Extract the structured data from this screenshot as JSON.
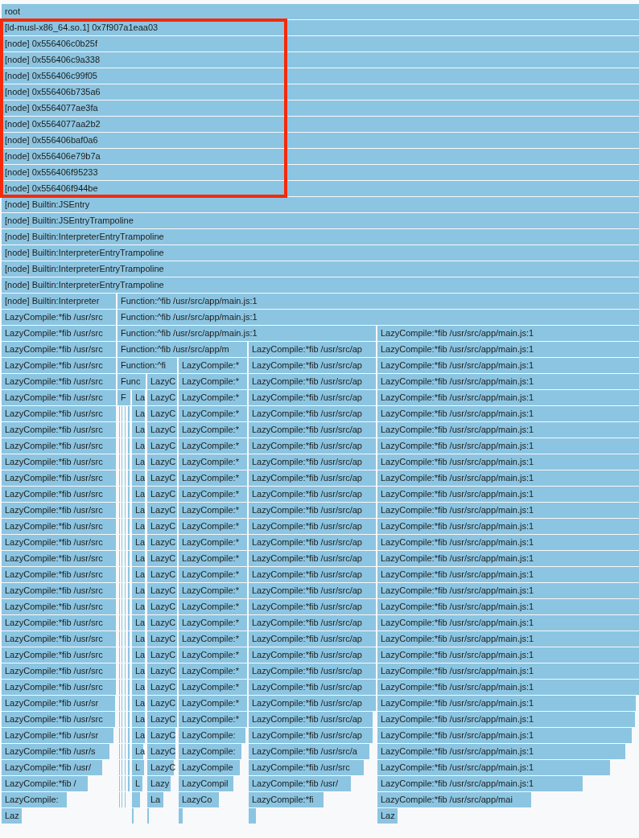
{
  "flame_graph": {
    "rows": [
      {
        "frames": [
          "root"
        ]
      },
      {
        "frames": [
          "[ld-musl-x86_64.so.1] 0x7f907a1eaa03"
        ]
      },
      {
        "frames": [
          "[node] 0x556406c0b25f"
        ]
      },
      {
        "frames": [
          "[node] 0x556406c9a338"
        ]
      },
      {
        "frames": [
          "[node] 0x556406c99f05"
        ]
      },
      {
        "frames": [
          "[node] 0x556406b735a6"
        ]
      },
      {
        "frames": [
          "[node] 0x5564077ae3fa"
        ]
      },
      {
        "frames": [
          "[node] 0x5564077aa2b2"
        ]
      },
      {
        "frames": [
          "[node] 0x556406baf0a6"
        ]
      },
      {
        "frames": [
          "[node] 0x556406e79b7a"
        ]
      },
      {
        "frames": [
          "[node] 0x556406f95233"
        ]
      },
      {
        "frames": [
          "[node] 0x556406f944be"
        ]
      },
      {
        "frames": [
          "[node] Builtin:JSEntry"
        ]
      },
      {
        "frames": [
          "[node] Builtin:JSEntryTrampoline"
        ]
      },
      {
        "frames": [
          "[node] Builtin:InterpreterEntryTrampoline"
        ]
      },
      {
        "frames": [
          "[node] Builtin:InterpreterEntryTrampoline"
        ]
      },
      {
        "frames": [
          "[node] Builtin:InterpreterEntryTrampoline"
        ]
      },
      {
        "frames": [
          "[node] Builtin:InterpreterEntryTrampoline"
        ]
      },
      {
        "frames": [
          "[node] Builtin:Interpreter",
          "Function:^fib /usr/src/app/main.js:1"
        ]
      },
      {
        "frames": [
          "LazyCompile:*fib /usr/src",
          "Function:^fib /usr/src/app/main.js:1"
        ]
      },
      {
        "frames": [
          "LazyCompile:*fib /usr/src",
          "Function:^fib /usr/src/app/main.js:1",
          "LazyCompile:*fib /usr/src/app/main.js:1"
        ]
      },
      {
        "frames": [
          "LazyCompile:*fib /usr/src",
          "Function:^fib /usr/src/app/m",
          "LazyCompile:*fib /usr/src/ap",
          "LazyCompile:*fib /usr/src/app/main.js:1"
        ]
      },
      {
        "frames": [
          "LazyCompile:*fib /usr/src",
          "Function:^fi",
          "LazyCompile:*",
          "LazyCompile:*fib /usr/src/ap",
          "LazyCompile:*fib /usr/src/app/main.js:1"
        ]
      },
      {
        "frames": [
          "LazyCompile:*fib /usr/src",
          "Func",
          "LazyC",
          "LazyCompile:*",
          "LazyCompile:*fib /usr/src/ap",
          "LazyCompile:*fib /usr/src/app/main.js:1"
        ]
      },
      {
        "frames": [
          "LazyCompile:*fib /usr/src",
          "F",
          "La",
          "LazyC",
          "LazyCompile:*",
          "LazyCompile:*fib /usr/src/ap",
          "LazyCompile:*fib /usr/src/app/main.js:1"
        ]
      },
      {
        "frames": [
          "LazyCompile:*fib /usr/src",
          "La",
          "LazyC",
          "LazyCompile:*",
          "LazyCompile:*fib /usr/src/ap",
          "LazyCompile:*fib /usr/src/app/main.js:1"
        ]
      },
      {
        "frames": [
          "LazyCompile:*fib /usr/src",
          "La",
          "LazyC",
          "LazyCompile:*",
          "LazyCompile:*fib /usr/src/ap",
          "LazyCompile:*fib /usr/src/app/main.js:1"
        ]
      },
      {
        "frames": [
          "LazyCompile:*fib /usr/src",
          "La",
          "LazyC",
          "LazyCompile:*",
          "LazyCompile:*fib /usr/src/ap",
          "LazyCompile:*fib /usr/src/app/main.js:1"
        ]
      },
      {
        "frames": [
          "LazyCompile:*fib /usr/src",
          "La",
          "LazyC",
          "LazyCompile:*",
          "LazyCompile:*fib /usr/src/ap",
          "LazyCompile:*fib /usr/src/app/main.js:1"
        ]
      },
      {
        "frames": [
          "LazyCompile:*fib /usr/src",
          "La",
          "LazyC",
          "LazyCompile:*",
          "LazyCompile:*fib /usr/src/ap",
          "LazyCompile:*fib /usr/src/app/main.js:1"
        ]
      },
      {
        "frames": [
          "LazyCompile:*fib /usr/src",
          "La",
          "LazyC",
          "LazyCompile:*",
          "LazyCompile:*fib /usr/src/ap",
          "LazyCompile:*fib /usr/src/app/main.js:1"
        ]
      },
      {
        "frames": [
          "LazyCompile:*fib /usr/src",
          "La",
          "LazyC",
          "LazyCompile:*",
          "LazyCompile:*fib /usr/src/ap",
          "LazyCompile:*fib /usr/src/app/main.js:1"
        ]
      },
      {
        "frames": [
          "LazyCompile:*fib /usr/src",
          "La",
          "LazyC",
          "LazyCompile:*",
          "LazyCompile:*fib /usr/src/ap",
          "LazyCompile:*fib /usr/src/app/main.js:1"
        ]
      },
      {
        "frames": [
          "LazyCompile:*fib /usr/src",
          "La",
          "LazyC",
          "LazyCompile:*",
          "LazyCompile:*fib /usr/src/ap",
          "LazyCompile:*fib /usr/src/app/main.js:1"
        ]
      },
      {
        "frames": [
          "LazyCompile:*fib /usr/src",
          "La",
          "LazyC",
          "LazyCompile:*",
          "LazyCompile:*fib /usr/src/ap",
          "LazyCompile:*fib /usr/src/app/main.js:1"
        ]
      },
      {
        "frames": [
          "LazyCompile:*fib /usr/src",
          "La",
          "LazyC",
          "LazyCompile:*",
          "LazyCompile:*fib /usr/src/ap",
          "LazyCompile:*fib /usr/src/app/main.js:1"
        ]
      },
      {
        "frames": [
          "LazyCompile:*fib /usr/src",
          "La",
          "LazyC",
          "LazyCompile:*",
          "LazyCompile:*fib /usr/src/ap",
          "LazyCompile:*fib /usr/src/app/main.js:1"
        ]
      },
      {
        "frames": [
          "LazyCompile:*fib /usr/src",
          "La",
          "LazyC",
          "LazyCompile:*",
          "LazyCompile:*fib /usr/src/ap",
          "LazyCompile:*fib /usr/src/app/main.js:1"
        ]
      },
      {
        "frames": [
          "LazyCompile:*fib /usr/src",
          "La",
          "LazyC",
          "LazyCompile:*",
          "LazyCompile:*fib /usr/src/ap",
          "LazyCompile:*fib /usr/src/app/main.js:1"
        ]
      },
      {
        "frames": [
          "LazyCompile:*fib /usr/src",
          "La",
          "LazyC",
          "LazyCompile:*",
          "LazyCompile:*fib /usr/src/ap",
          "LazyCompile:*fib /usr/src/app/main.js:1"
        ]
      },
      {
        "frames": [
          "LazyCompile:*fib /usr/src",
          "La",
          "LazyC",
          "LazyCompile:*",
          "LazyCompile:*fib /usr/src/ap",
          "LazyCompile:*fib /usr/src/app/main.js:1"
        ]
      },
      {
        "frames": [
          "LazyCompile:*fib /usr/src",
          "La",
          "LazyC",
          "LazyCompile:*",
          "LazyCompile:*fib /usr/src/ap",
          "LazyCompile:*fib /usr/src/app/main.js:1"
        ]
      },
      {
        "frames": [
          "LazyCompile:*fib /usr/src",
          "La",
          "LazyC",
          "LazyCompile:*",
          "LazyCompile:*fib /usr/src/ap",
          "LazyCompile:*fib /usr/src/app/main.js:1"
        ]
      },
      {
        "frames": [
          "LazyCompile:*fib /usr/sr",
          "La",
          "LazyC",
          "LazyCompile:*",
          "LazyCompile:*fib /usr/src/ap",
          "LazyCompile:*fib /usr/src/app/main.js:1"
        ]
      },
      {
        "frames": [
          "LazyCompile:*fib /usr/src",
          "La",
          "LazyC",
          "LazyCompile:*",
          "LazyCompile:*fib /usr/src/ap",
          "LazyCompile:*fib /usr/src/app/main.js:1"
        ]
      },
      {
        "frames": [
          "LazyCompile:*fib /usr/sr",
          "La",
          "LazyC",
          "LazyCompile:",
          "LazyCompile:*fib /usr/src/ap",
          "LazyCompile:*fib /usr/src/app/main.js:1"
        ]
      },
      {
        "frames": [
          "LazyCompile:*fib /usr/s",
          "La",
          "LazyC",
          "LazyCompile:",
          "LazyCompile:*fib /usr/src/a",
          "LazyCompile:*fib /usr/src/app/main.js:1"
        ]
      },
      {
        "frames": [
          "LazyCompile:*fib /usr/",
          "L",
          "LazyC",
          "LazyCompile",
          "LazyCompile:*fib /usr/src",
          "LazyCompile:*fib /usr/src/app/main.js:1"
        ]
      },
      {
        "frames": [
          "LazyCompile:*fib /",
          "L",
          "Lazy",
          "LazyCompil",
          "LazyCompile:*fib /usr/",
          "LazyCompile:*fib /usr/src/app/main.js:1"
        ]
      },
      {
        "frames": [
          "LazyCompile:",
          "La",
          "LazyCo",
          "LazyCompile:*fi",
          "LazyCompile:*fib /usr/src/app/mai"
        ]
      },
      {
        "frames": [
          "Laz",
          "Laz"
        ]
      }
    ]
  }
}
